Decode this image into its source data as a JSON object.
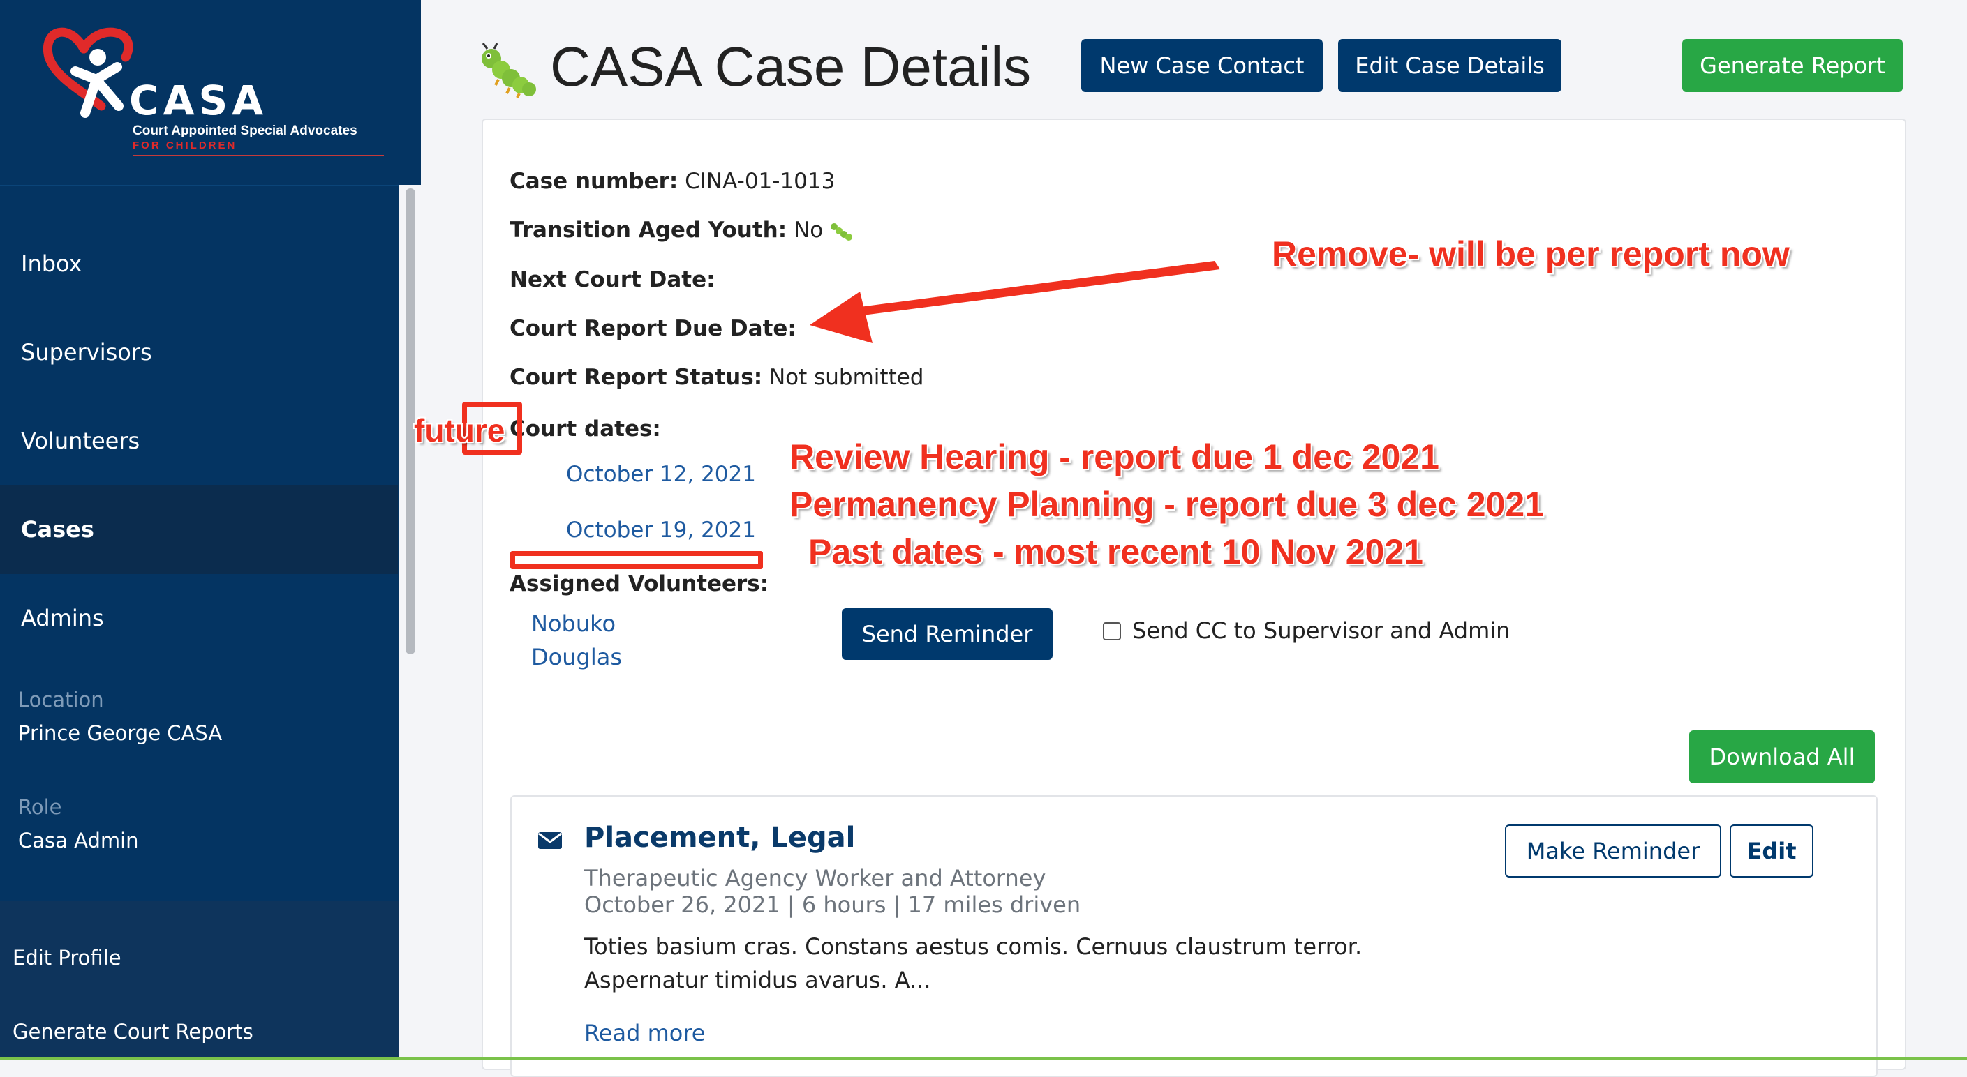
{
  "sidebar": {
    "logo": {
      "word": "CASA",
      "tagline": "Court Appointed Special Advocates",
      "subtag": "FOR CHILDREN"
    },
    "nav": [
      {
        "label": "Inbox",
        "active": false
      },
      {
        "label": "Supervisors",
        "active": false
      },
      {
        "label": "Volunteers",
        "active": false
      },
      {
        "label": "Cases",
        "active": true
      },
      {
        "label": "Admins",
        "active": false
      }
    ],
    "location_label": "Location",
    "location_value": "Prince George CASA",
    "role_label": "Role",
    "role_value": "Casa Admin",
    "edit_profile": "Edit Profile",
    "generate_court_reports": "Generate Court Reports"
  },
  "header": {
    "title": "CASA Case Details",
    "title_icon": "caterpillar-icon",
    "new_case_contact": "New Case Contact",
    "edit_case_details": "Edit Case Details",
    "generate_report": "Generate Report"
  },
  "case": {
    "case_number_label": "Case number:",
    "case_number": "CINA-01-1013",
    "transition_label": "Transition Aged Youth:",
    "transition_value": "No",
    "next_court_date_label": "Next Court Date:",
    "report_due_label": "Court Report Due Date:",
    "report_status_label": "Court Report Status:",
    "report_status_value": "Not submitted",
    "court_dates_label": "Court dates:",
    "court_dates": [
      "October 12, 2021",
      "October 19, 2021"
    ],
    "assigned_volunteers_label": "Assigned Volunteers:",
    "volunteers": [
      "Nobuko",
      "Douglas"
    ],
    "send_reminder": "Send Reminder",
    "send_cc_label": "Send CC to Supervisor and Admin",
    "download_all": "Download All"
  },
  "contact": {
    "title": "Placement, Legal",
    "contact_types": "Therapeutic Agency Worker and Attorney",
    "details": "October 26, 2021 | 6 hours | 17 miles driven",
    "notes_line1": "Toties basium cras. Constans aestus comis. Cernuus claustrum terror.",
    "notes_line2": "Aspernatur timidus avarus. A...",
    "read_more": "Read more",
    "make_reminder": "Make Reminder",
    "edit": "Edit"
  },
  "annotations": {
    "remove": "Remove- will be per report now",
    "future": "future",
    "review": "Review Hearing - report due 1 dec 2021",
    "permanency": "Permanency Planning - report due 3 dec 2021",
    "past": "Past dates - most recent 10 Nov 2021"
  },
  "colors": {
    "sidebar": "#043462",
    "navy_button": "#00396d",
    "green_button": "#28a745",
    "annotation_red": "#f0301f",
    "link_blue": "#1e5aa0"
  }
}
